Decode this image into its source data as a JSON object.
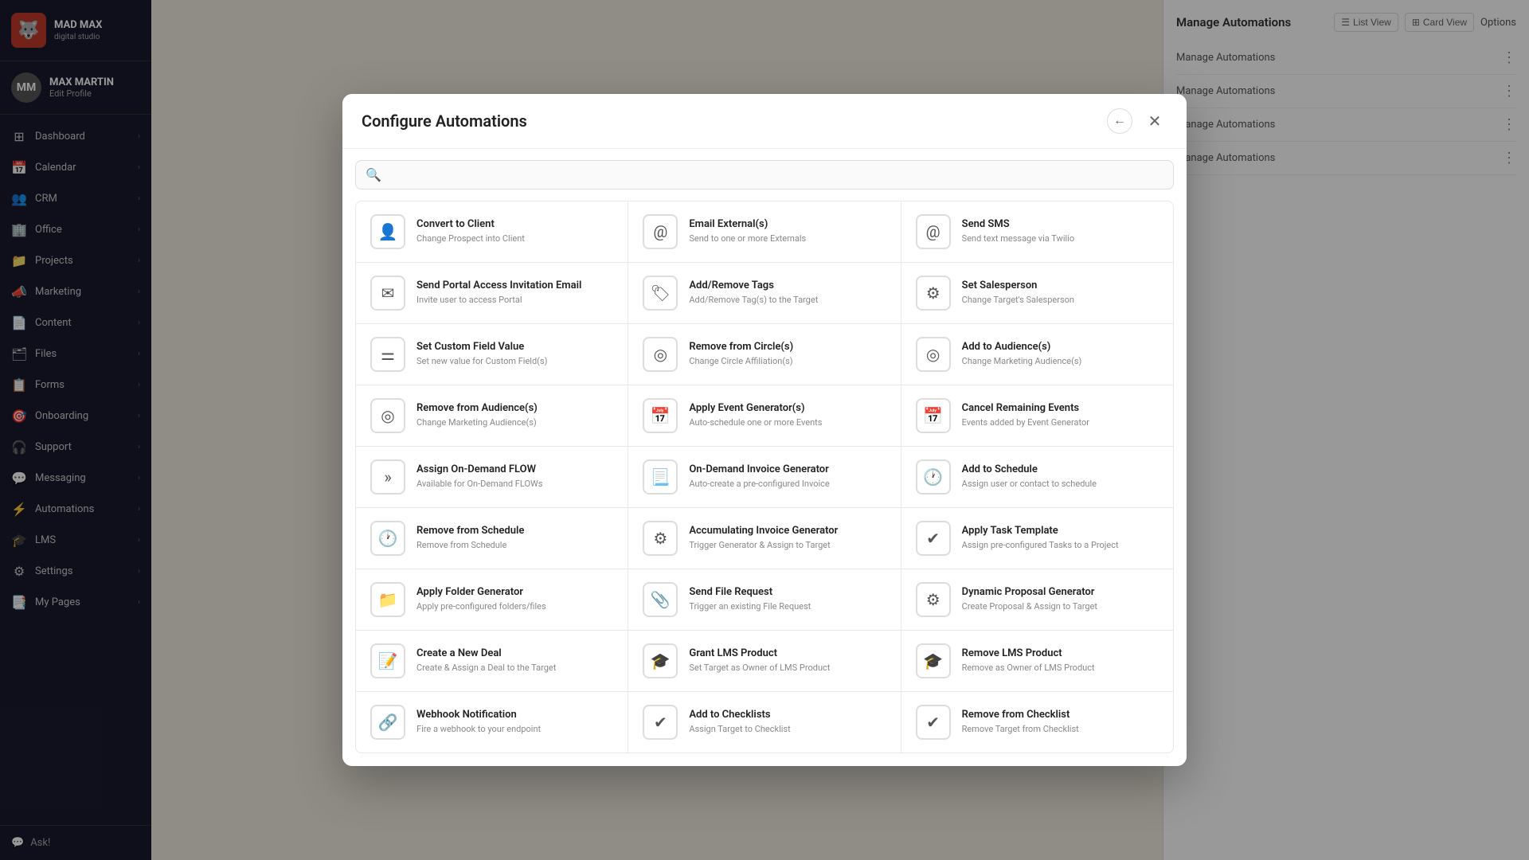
{
  "app": {
    "logo_icon": "🐺",
    "logo_name": "MAD MAX",
    "logo_sub": "digital studio"
  },
  "profile": {
    "name": "MAX MARTIN",
    "edit_label": "Edit Profile",
    "initials": "MM"
  },
  "sidebar": {
    "items": [
      {
        "id": "dashboard",
        "label": "Dashboard",
        "icon": "⊞",
        "has_arrow": true
      },
      {
        "id": "calendar",
        "label": "Calendar",
        "icon": "📅",
        "has_arrow": true
      },
      {
        "id": "crm",
        "label": "CRM",
        "icon": "👥",
        "has_arrow": true
      },
      {
        "id": "office",
        "label": "Office",
        "icon": "🏢",
        "has_arrow": true
      },
      {
        "id": "projects",
        "label": "Projects",
        "icon": "📁",
        "has_arrow": true
      },
      {
        "id": "marketing",
        "label": "Marketing",
        "icon": "📣",
        "has_arrow": true
      },
      {
        "id": "content",
        "label": "Content",
        "icon": "📄",
        "has_arrow": true
      },
      {
        "id": "files",
        "label": "Files",
        "icon": "🗂",
        "has_arrow": true
      },
      {
        "id": "forms",
        "label": "Forms",
        "icon": "📋",
        "has_arrow": true
      },
      {
        "id": "onboarding",
        "label": "Onboarding",
        "icon": "🎯",
        "has_arrow": true
      },
      {
        "id": "support",
        "label": "Support",
        "icon": "🎧",
        "has_arrow": true
      },
      {
        "id": "messaging",
        "label": "Messaging",
        "icon": "💬",
        "has_arrow": true
      },
      {
        "id": "automations",
        "label": "Automations",
        "icon": "⚡",
        "has_arrow": true
      },
      {
        "id": "lms",
        "label": "LMS",
        "icon": "🎓",
        "has_arrow": true
      },
      {
        "id": "settings",
        "label": "Settings",
        "icon": "⚙",
        "has_arrow": true
      },
      {
        "id": "mypages",
        "label": "My Pages",
        "icon": "📑",
        "has_arrow": true
      }
    ],
    "ask_label": "Ask!"
  },
  "modal": {
    "title": "Configure Automations",
    "search_placeholder": "",
    "close_label": "×",
    "back_label": "←",
    "automations": [
      {
        "id": "convert-to-client",
        "title": "Convert to Client",
        "desc": "Change Prospect into Client",
        "icon": "👤"
      },
      {
        "id": "email-externals",
        "title": "Email External(s)",
        "desc": "Send to one or more Externals",
        "icon": "@"
      },
      {
        "id": "send-sms",
        "title": "Send SMS",
        "desc": "Send text message via Twilio",
        "icon": "@"
      },
      {
        "id": "send-portal-invite",
        "title": "Send Portal Access Invitation Email",
        "desc": "Invite user to access Portal",
        "icon": "✉"
      },
      {
        "id": "add-remove-tags",
        "title": "Add/Remove Tags",
        "desc": "Add/Remove Tag(s) to the Target",
        "icon": "🏷"
      },
      {
        "id": "set-salesperson",
        "title": "Set Salesperson",
        "desc": "Change Target's Salesperson",
        "icon": "⚙"
      },
      {
        "id": "set-custom-field",
        "title": "Set Custom Field Value",
        "desc": "Set new value for Custom Field(s)",
        "icon": "≡"
      },
      {
        "id": "remove-from-circle",
        "title": "Remove from Circle(s)",
        "desc": "Change Circle Affiliation(s)",
        "icon": "◎"
      },
      {
        "id": "add-to-audiences",
        "title": "Add to Audience(s)",
        "desc": "Change Marketing Audience(s)",
        "icon": "🎯"
      },
      {
        "id": "remove-from-audiences",
        "title": "Remove from Audience(s)",
        "desc": "Change Marketing Audience(s)",
        "icon": "🎯"
      },
      {
        "id": "apply-event-generator",
        "title": "Apply Event Generator(s)",
        "desc": "Auto-schedule one or more Events",
        "icon": "📅"
      },
      {
        "id": "cancel-remaining-events",
        "title": "Cancel Remaining Events",
        "desc": "Events added by Event Generator",
        "icon": "📅"
      },
      {
        "id": "assign-on-demand-flow",
        "title": "Assign On-Demand FLOW",
        "desc": "Available for On-Demand FLOWs",
        "icon": "»"
      },
      {
        "id": "on-demand-invoice-generator",
        "title": "On-Demand Invoice Generator",
        "desc": "Auto-create a pre-configured Invoice",
        "icon": "📋"
      },
      {
        "id": "add-to-schedule",
        "title": "Add to Schedule",
        "desc": "Assign user or contact to schedule",
        "icon": "🕐"
      },
      {
        "id": "remove-from-schedule",
        "title": "Remove from Schedule",
        "desc": "Remove from Schedule",
        "icon": "🕐"
      },
      {
        "id": "accumulating-invoice-generator",
        "title": "Accumulating Invoice Generator",
        "desc": "Trigger Generator & Assign to Target",
        "icon": "⚙"
      },
      {
        "id": "apply-task-template",
        "title": "Apply Task Template",
        "desc": "Assign pre-configured Tasks to a Project",
        "icon": "✓"
      },
      {
        "id": "apply-folder-generator",
        "title": "Apply Folder Generator",
        "desc": "Apply pre-configured folders/files",
        "icon": "📁"
      },
      {
        "id": "send-file-request",
        "title": "Send File Request",
        "desc": "Trigger an existing File Request",
        "icon": "📎"
      },
      {
        "id": "dynamic-proposal-generator",
        "title": "Dynamic Proposal Generator",
        "desc": "Create Proposal & Assign to Target",
        "icon": "⚙"
      },
      {
        "id": "create-new-deal",
        "title": "Create a New Deal",
        "desc": "Create & Assign a Deal to the Target",
        "icon": "📝"
      },
      {
        "id": "grant-lms-product",
        "title": "Grant LMS Product",
        "desc": "Set Target as Owner of LMS Product",
        "icon": "🎓"
      },
      {
        "id": "remove-lms-product",
        "title": "Remove LMS Product",
        "desc": "Remove as Owner of LMS Product",
        "icon": "🎓"
      },
      {
        "id": "webhook-notification",
        "title": "Webhook Notification",
        "desc": "Fire a webhook to your endpoint",
        "icon": "🔗"
      },
      {
        "id": "add-to-checklists",
        "title": "Add to Checklists",
        "desc": "Assign Target to Checklist",
        "icon": "✓"
      },
      {
        "id": "remove-from-checklist",
        "title": "Remove from Checklist",
        "desc": "Remove Target from Checklist",
        "icon": "✓"
      }
    ]
  },
  "right_panel": {
    "manage_automations_label": "Manage Automations",
    "options_label": "Options",
    "list_view_label": "List View",
    "card_view_label": "Card View"
  }
}
